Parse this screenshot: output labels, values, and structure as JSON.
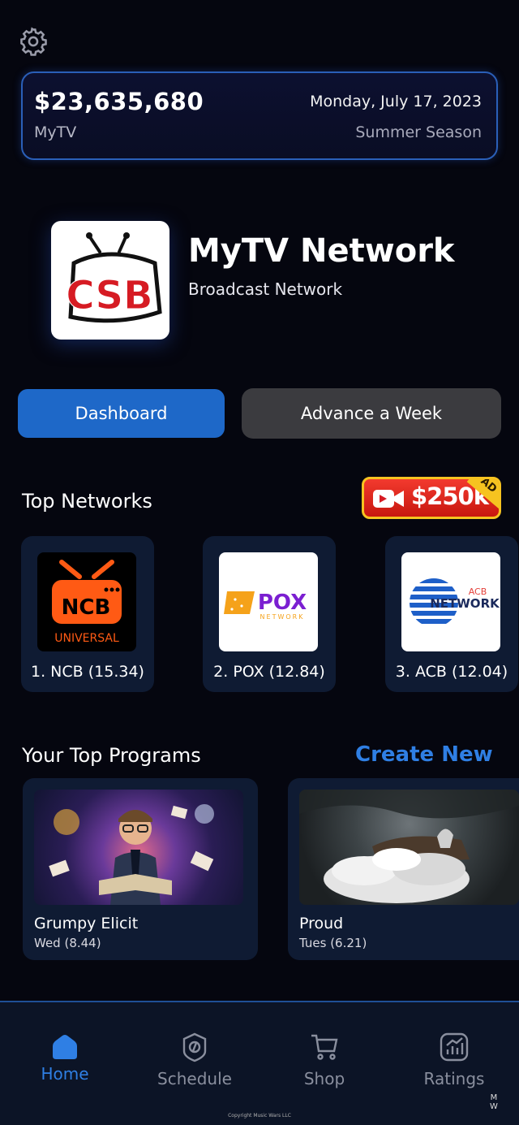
{
  "settings": {
    "icon": "gear-icon"
  },
  "status": {
    "money": "$23,635,680",
    "owner": "MyTV",
    "date": "Monday, July 17, 2023",
    "season": "Summer Season"
  },
  "network": {
    "logo_text": "CSB",
    "title": "MyTV Network",
    "subtitle": "Broadcast Network"
  },
  "actions": {
    "dashboard": "Dashboard",
    "advance": "Advance a Week"
  },
  "top_networks": {
    "title": "Top Networks",
    "ad": {
      "amount": "$250k",
      "label": "AD",
      "icon": "video-camera-icon"
    },
    "items": [
      {
        "rank_label": "1. NCB (15.34)",
        "logo_main": "NCB",
        "logo_sub": "UNIVERSAL",
        "accent": "#ff5a14"
      },
      {
        "rank_label": "2. POX (12.84)",
        "logo_main": "POX",
        "logo_sub": "NETWORK",
        "accent": "#7b1fd1"
      },
      {
        "rank_label": "3. ACB (12.04)",
        "logo_main": "NETWORK",
        "logo_sub": "ACB",
        "accent": "#1e5fc8"
      }
    ]
  },
  "programs": {
    "title": "Your Top Programs",
    "create_label": "Create New",
    "items": [
      {
        "name": "Grumpy Elicit",
        "day_rating": "Wed (8.44)"
      },
      {
        "name": "Proud",
        "day_rating": "Tues (6.21)"
      }
    ]
  },
  "nav": {
    "items": [
      {
        "label": "Home",
        "icon": "home-icon",
        "active": true
      },
      {
        "label": "Schedule",
        "icon": "schedule-icon",
        "active": false
      },
      {
        "label": "Shop",
        "icon": "cart-icon",
        "active": false
      },
      {
        "label": "Ratings",
        "icon": "ratings-chart-icon",
        "active": false
      }
    ]
  },
  "footer": {
    "copyright": "Copyright Music Wars LLC",
    "mark_top": "M",
    "mark_bottom": "W"
  },
  "colors": {
    "accent": "#2f7fe4",
    "background": "#05060f",
    "card": "#0f1b33"
  }
}
